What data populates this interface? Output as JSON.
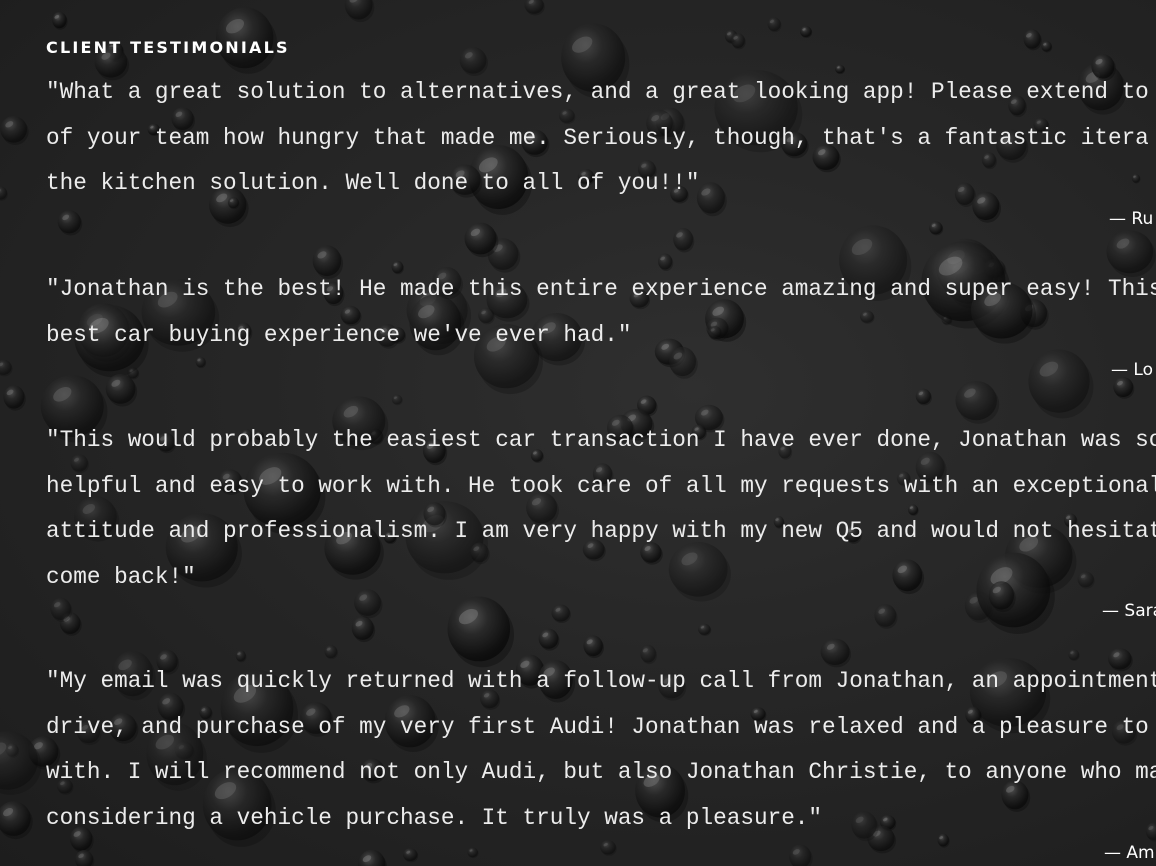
{
  "section": {
    "heading": "CLIENT TESTIMONIALS"
  },
  "testimonials": [
    {
      "lines": [
        "\"What a great solution to alternatives, and a great looking app! Please extend to",
        "of your team how hungry that made me. Seriously, though, that's a fantastic itera",
        "the kitchen solution. Well done to all of you!!\""
      ],
      "attribution": "— Ru"
    },
    {
      "lines": [
        "\"Jonathan is the best! He made this entire experience amazing and super easy! This",
        "best car buying experience we've ever had.\""
      ],
      "attribution": "— Lo"
    },
    {
      "lines": [
        "\"This would probably the easiest car transaction I have ever done, Jonathan was so",
        "helpful and easy to work with. He took care of all my requests with an exceptional",
        "attitude and professionalism. I am very happy with my new Q5 and would not hesitat",
        "come back!\""
      ],
      "attribution": "— Sara"
    },
    {
      "lines": [
        "\"My email was quickly returned with a follow-up call from Jonathan, an appointment",
        "drive, and purchase of my very first Audi! Jonathan was relaxed and a pleasure to",
        "with. I will recommend not only Audi, but also Jonathan Christie, to anyone who ma",
        "considering a vehicle purchase. It truly was a pleasure.\""
      ],
      "attribution": "— Am"
    }
  ]
}
